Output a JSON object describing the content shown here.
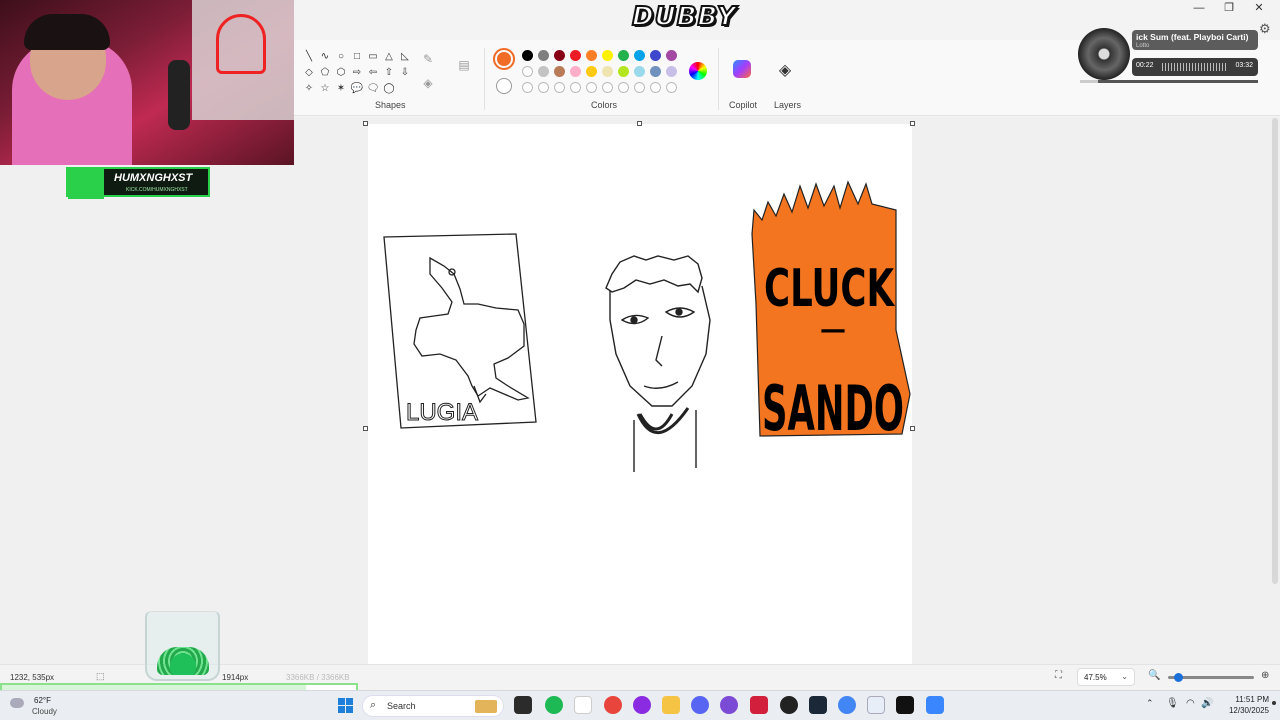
{
  "overlay": {
    "stream_title": "DUBBY",
    "streamer_name": "HUMXNGHXST",
    "streamer_link": "KICK.COM/HUMXNGHXST"
  },
  "window": {
    "buttons": [
      "—",
      "❐",
      "✕"
    ]
  },
  "ribbon": {
    "shapes_label": "Shapes",
    "colors_label": "Colors",
    "copilot_label": "Copilot",
    "layers_label": "Layers",
    "shapes": [
      "╲",
      "∿",
      "○",
      "□",
      "▭",
      "△",
      "◺",
      "◇",
      "⬠",
      "⬡",
      "⇨",
      "⇦",
      "⇧",
      "⇩",
      "✧",
      "☆",
      "✶",
      "💬",
      "🗨",
      "◯"
    ],
    "active_color": "#f06b26",
    "palette_row1": [
      "#000000",
      "#7f7f7f",
      "#880015",
      "#ed1c24",
      "#ff7f27",
      "#fff200",
      "#22b14c",
      "#00a2e8",
      "#3f48cc",
      "#a349a4"
    ],
    "palette_row2": [
      "#ffffff",
      "#c3c3c3",
      "#b97a57",
      "#ffaec9",
      "#ffc90e",
      "#efe4b0",
      "#b5e61d",
      "#99d9ea",
      "#7092be",
      "#c8bfe7"
    ],
    "palette_row3_empty": 10
  },
  "music": {
    "title": "ick Sum (feat. Playboi Carti)",
    "artist": "Lotto",
    "elapsed": "00:22",
    "duration": "03:32",
    "progress": 0.1
  },
  "drawings": {
    "card_text": "LUGIA",
    "bag_line1": "CLUCK",
    "bag_dash": "—",
    "bag_line2": "SANDO"
  },
  "status": {
    "cursor_pos": "1232, 535px",
    "canvas_size": "1914px",
    "file_size": "3366KB / 3366KB",
    "zoom": "47.5%",
    "upload_progress": 0.86
  },
  "taskbar": {
    "temperature": "62°F",
    "weather": "Cloudy",
    "search_placeholder": "Search",
    "time": "11:51 PM",
    "date": "12/30/2025",
    "weather_alert": "4"
  },
  "colors": {
    "accent": "#f06b26",
    "windows_blue": "#1d7fd9",
    "kick_green": "#2bd04a"
  }
}
